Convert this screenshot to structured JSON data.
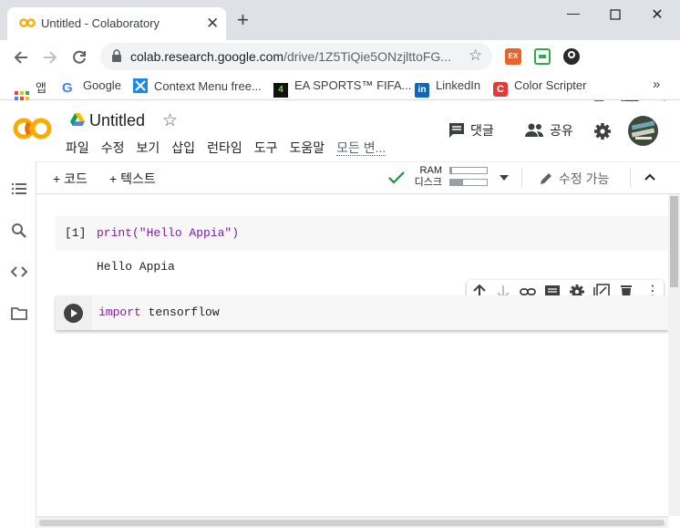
{
  "browser": {
    "tab_title": "Untitled - Colaboratory",
    "url_host": "colab.research.google.com",
    "url_path": "/drive/1Z5TiQie5ONzjlttoFG...",
    "bookmarks": [
      "앱",
      "Google",
      "Context Menu free...",
      "EA SPORTS™ FIFA...",
      "LinkedIn",
      "Color Scripter"
    ]
  },
  "colab": {
    "notebook_title": "Untitled",
    "menu": [
      "파일",
      "수정",
      "보기",
      "삽입",
      "런타임",
      "도구",
      "도움말",
      "모든 변..."
    ],
    "comment_label": "댓글",
    "share_label": "공유",
    "add_code_label": "+ 코드",
    "add_text_label": "+ 텍스트",
    "ram_label": "RAM",
    "disk_label": "디스크",
    "edit_mode_label": "수정 가능"
  },
  "cells": {
    "cell1_count": "[1]",
    "cell1_code": "print(\"Hello Appia\")",
    "cell1_output": "Hello Appia",
    "cell2_keyword": "import",
    "cell2_rest": " tensorflow"
  },
  "colors": {
    "colab_orange": "#f9ab00",
    "check_green": "#1e8e3e",
    "keyword_purple": "#af00db"
  }
}
